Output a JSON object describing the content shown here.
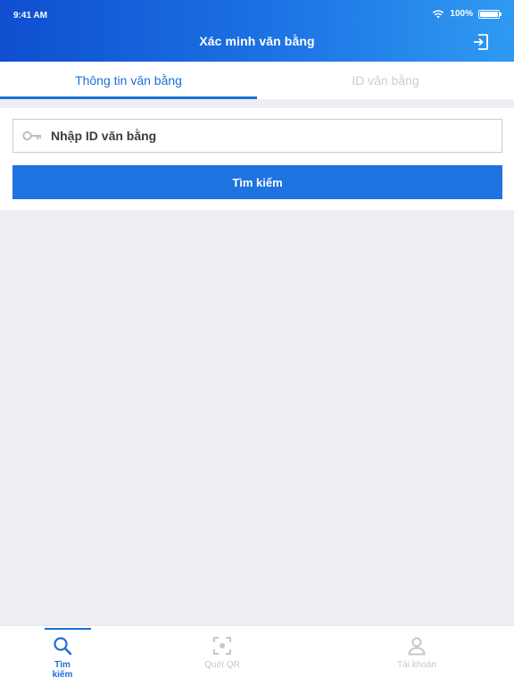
{
  "status_bar": {
    "time": "9:41 AM",
    "battery": "100%"
  },
  "header": {
    "title": "Xác minh văn bằng",
    "action_icon": "logout-icon"
  },
  "tabs": [
    {
      "label": "Thông tin văn bằng",
      "active": true
    },
    {
      "label": "ID văn bằng",
      "active": false
    }
  ],
  "search": {
    "placeholder": "Nhập ID văn bằng",
    "value": "",
    "button_label": "Tìm kiếm",
    "icon": "key-icon"
  },
  "bottom_nav": [
    {
      "label": "Tìm kiếm",
      "icon": "search-icon",
      "active": true
    },
    {
      "label": "Quét QR",
      "icon": "qr-scan-icon",
      "active": false
    },
    {
      "label": "Tài khoản",
      "icon": "user-icon",
      "active": false
    }
  ],
  "colors": {
    "primary": "#1b6fd7",
    "header_start": "#0f4fd0",
    "header_end": "#2f9af2",
    "background": "#eceef2",
    "inactive": "#c4c8cd"
  }
}
